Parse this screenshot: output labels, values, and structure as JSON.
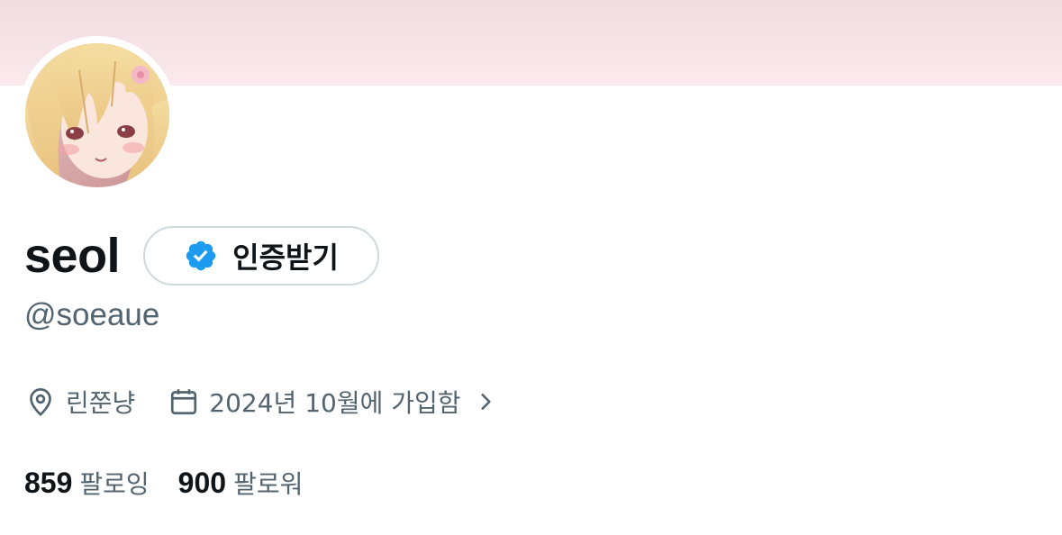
{
  "profile": {
    "display_name": "seol",
    "handle": "@soeaue",
    "verify_label": "인증받기",
    "location": "린쭌냥",
    "joined": "2024년 10월에 가입함",
    "following_count": "859",
    "following_label": "팔로잉",
    "followers_count": "900",
    "followers_label": "팔로워"
  },
  "icons": {
    "verify": "verified-badge-icon",
    "location": "location-pin-icon",
    "calendar": "calendar-icon",
    "chevron": "chevron-right-icon"
  },
  "colors": {
    "banner": "#f6e3e7",
    "verified_blue": "#1d9bf0",
    "secondary_text": "#536471",
    "primary_text": "#0f1419",
    "border": "#cfd9de"
  }
}
